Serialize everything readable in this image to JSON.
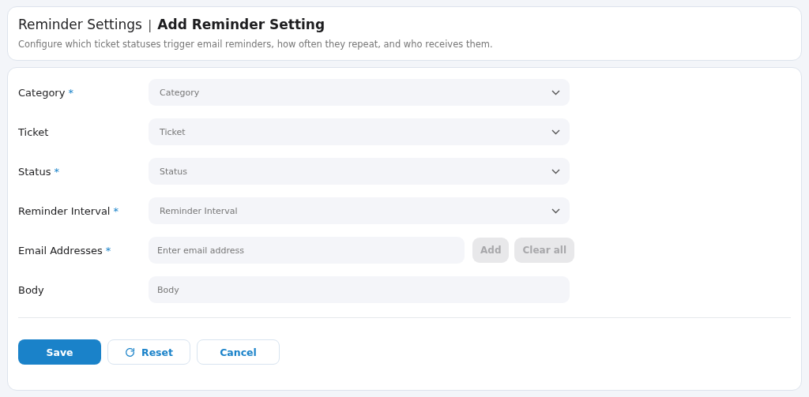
{
  "header": {
    "breadcrumb": "Reminder Settings",
    "separator": "|",
    "title": "Add Reminder Setting",
    "description": "Configure which ticket statuses trigger email reminders, how often they repeat, and who receives them."
  },
  "fields": [
    {
      "kind": "select",
      "label": "Category",
      "required": true,
      "placeholder": "Category"
    },
    {
      "kind": "select",
      "label": "Ticket",
      "required": false,
      "placeholder": "Ticket"
    },
    {
      "kind": "select",
      "label": "Status",
      "required": true,
      "placeholder": "Status"
    },
    {
      "kind": "select",
      "label": "Reminder Interval",
      "required": true,
      "placeholder": "Reminder Interval"
    },
    {
      "kind": "email",
      "label": "Email Addresses",
      "required": true,
      "placeholder": "Enter email address",
      "buttons": [
        {
          "label": "Add",
          "disabled": true
        },
        {
          "label": "Clear all",
          "disabled": true
        }
      ]
    },
    {
      "kind": "text",
      "label": "Body",
      "required": false,
      "placeholder": "Body"
    }
  ],
  "required_mark": "*",
  "actions": [
    {
      "kind": "primary",
      "label": "Save"
    },
    {
      "kind": "reset",
      "label": "Reset"
    },
    {
      "kind": "secondary",
      "label": "Cancel"
    }
  ]
}
